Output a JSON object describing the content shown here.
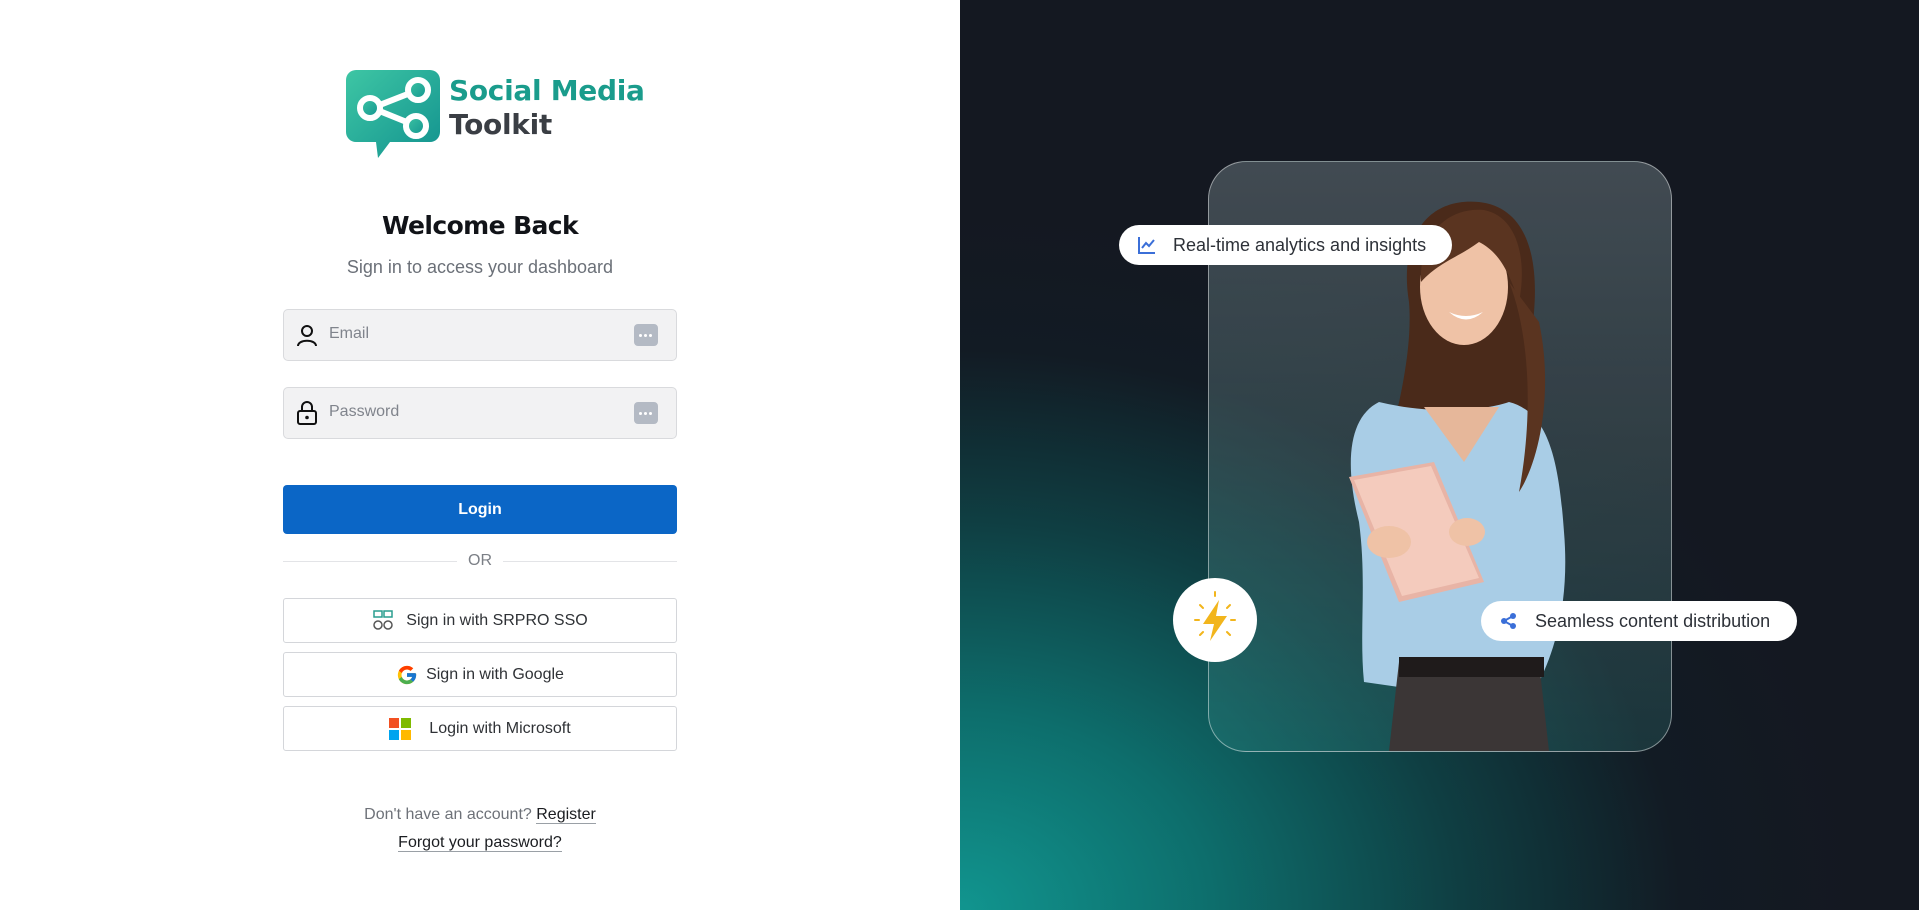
{
  "brand": {
    "line1": "Social Media",
    "line2": "Toolkit",
    "accent": "#1a9c8c"
  },
  "login": {
    "title": "Welcome Back",
    "subtitle": "Sign in to access your dashboard",
    "email_placeholder": "Email",
    "password_placeholder": "Password",
    "login_label": "Login",
    "or_label": "OR",
    "sso_label": "Sign in with SRPRO SSO",
    "google_label": "Sign in with Google",
    "microsoft_label": "Login with Microsoft",
    "no_account_text": "Don't have an account?",
    "register_label": "Register",
    "forgot_label": "Forgot your password?",
    "primary_color": "#0b66c6"
  },
  "hero": {
    "feature1": "Real-time analytics and insights",
    "feature2": "Seamless content distribution",
    "icons": [
      "chart-line-icon",
      "share-icon",
      "lightning-bolt-icon"
    ]
  }
}
